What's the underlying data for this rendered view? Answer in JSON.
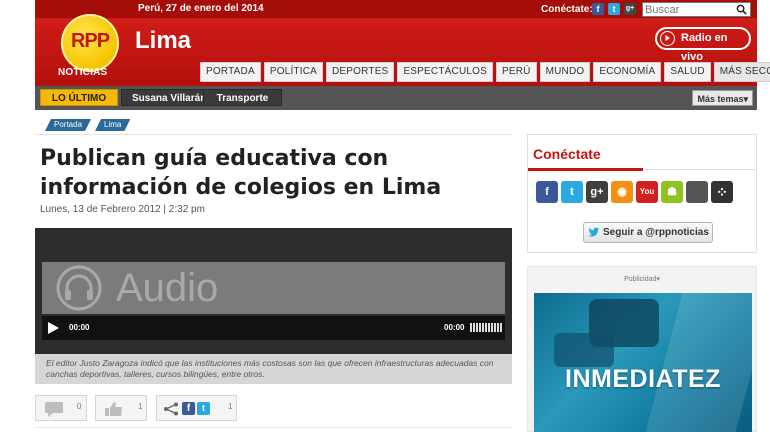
{
  "header": {
    "date": "Perú, 27 de enero del 2014",
    "connect_label": "Conéctate:",
    "search_placeholder": "Buscar",
    "logo_text": "RPP",
    "logo_subtitle": "NOTICIAS",
    "section_title": "Lima",
    "radio_label": "Radio en vivo",
    "nav": [
      "PORTADA",
      "POLÍTICA",
      "DEPORTES",
      "ESPECTÁCULOS",
      "PERÚ",
      "MUNDO",
      "ECONOMÍA",
      "SALUD"
    ],
    "nav_more": "MÁS SECCIONES ▾",
    "top_social_icons": [
      "facebook-icon",
      "twitter-icon",
      "google-plus-icon"
    ]
  },
  "subnav": {
    "latest": "LO ÚLTIMO",
    "topics": [
      "Susana Villarán",
      "Transporte"
    ],
    "more_topics": "Más temas▾"
  },
  "breadcrumb": [
    "Portada",
    "Lima"
  ],
  "article": {
    "headline": "Publican guía educativa con información de colegios en Lima",
    "date": "Lunes, 13 de Febrero 2012  |  2:32 pm",
    "player": {
      "label": "Audio",
      "time_current": "00:00",
      "time_total": "00:00"
    },
    "caption": "El editor Justo Zaragoza indicó que las instituciones más costosas son las que ofrecen infraestructuras adecuadas con canchas deportivas, talleres, cursos bilingües, entre otros.",
    "share": {
      "comments_count": "0",
      "likes_count": "1",
      "shares_count": "1"
    }
  },
  "sidebar": {
    "connect_title": "Conéctate",
    "social_icons": [
      {
        "icon": "facebook-icon",
        "glyph": "f",
        "color": "#3b5998"
      },
      {
        "icon": "twitter-icon",
        "glyph": "t",
        "color": "#2aa9e0"
      },
      {
        "icon": "google-plus-icon",
        "glyph": "g+",
        "color": "#3f3f3f"
      },
      {
        "icon": "rss-icon",
        "glyph": "◉",
        "color": "#f29111"
      },
      {
        "icon": "youtube-icon",
        "glyph": "You",
        "color": "#d42020"
      },
      {
        "icon": "android-icon",
        "glyph": "☗",
        "color": "#8fc31f"
      },
      {
        "icon": "apple-icon",
        "glyph": "",
        "color": "#555555"
      },
      {
        "icon": "blackberry-icon",
        "glyph": "⁘",
        "color": "#333333"
      }
    ],
    "follow_button": "Seguir a @rppnoticias",
    "ad_label": "Publicidad▾",
    "ad_text": "INMEDIATEZ"
  },
  "colors": {
    "brand_red": "#c4160f",
    "logo_yellow": "#f5c400",
    "breadcrumb_blue": "#2a6a9a"
  }
}
